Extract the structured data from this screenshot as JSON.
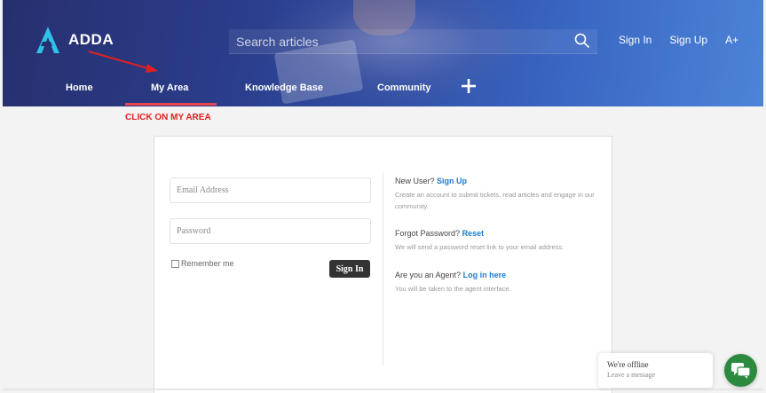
{
  "brand": {
    "name": "ADDA"
  },
  "search": {
    "placeholder": "Search articles"
  },
  "top_links": {
    "sign_in": "Sign In",
    "sign_up": "Sign Up",
    "font_size": "A+"
  },
  "nav": {
    "items": [
      "Home",
      "My Area",
      "Knowledge Base",
      "Community"
    ],
    "active": "My Area"
  },
  "annotation": {
    "text": "CLICK ON MY AREA",
    "color": "#e02020"
  },
  "login": {
    "email_placeholder": "Email Address",
    "password_placeholder": "Password",
    "remember_label": "Remember me",
    "signin_label": "Sign In"
  },
  "info": {
    "new_user_prefix": "New User?",
    "new_user_link": "Sign Up",
    "new_user_desc": "Create an account to submit tickets, read articles and engage in our community.",
    "forgot_prefix": "Forgot Password?",
    "forgot_link": "Reset",
    "forgot_desc": "We will send a password reset link to your email address.",
    "agent_prefix": "Are you an Agent?",
    "agent_link": "Log in here",
    "agent_desc": "You will be taken to the agent interface."
  },
  "chat": {
    "status": "We're offline",
    "action": "Leave a message"
  },
  "colors": {
    "accent": "#1b7ccc",
    "nav_underline": "#e8444f",
    "chat_green": "#2b8a3e",
    "header_dark": "#27306e"
  },
  "icons": {
    "logo": "adda-logo-icon",
    "search": "search-icon",
    "plus": "plus-icon",
    "chat": "chat-bubbles-icon"
  }
}
